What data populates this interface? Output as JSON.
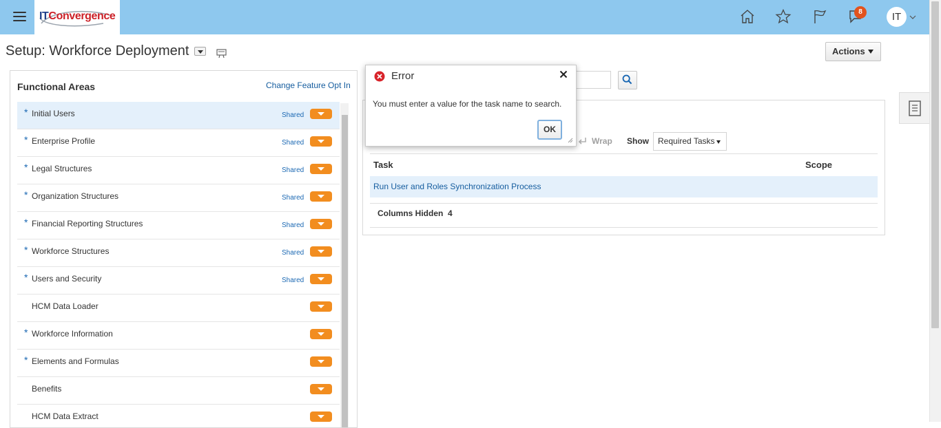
{
  "header": {
    "logo": {
      "part1": "IT",
      "part2": "Convergence",
      "brand_colors": {
        "it": "#1f3f8a",
        "conv": "#cc2027"
      }
    },
    "menu_icon": "hamburger-menu-icon",
    "icons": [
      "home-icon",
      "star-icon",
      "flag-icon",
      "notifications-icon"
    ],
    "notification_count": "8",
    "user_initials": "IT",
    "bar_color": "#8ec8ee"
  },
  "page": {
    "title": "Setup: Workforce Deployment",
    "actions_label": "Actions"
  },
  "functional_areas": {
    "heading": "Functional Areas",
    "change_link": "Change Feature Opt In",
    "items": [
      {
        "label": "Initial Users",
        "required": true,
        "shared": "Shared",
        "selected": true
      },
      {
        "label": "Enterprise Profile",
        "required": true,
        "shared": "Shared"
      },
      {
        "label": "Legal Structures",
        "required": true,
        "shared": "Shared"
      },
      {
        "label": "Organization Structures",
        "required": true,
        "shared": "Shared"
      },
      {
        "label": "Financial Reporting Structures",
        "required": true,
        "shared": "Shared"
      },
      {
        "label": "Workforce Structures",
        "required": true,
        "shared": "Shared"
      },
      {
        "label": "Users and Security",
        "required": true,
        "shared": "Shared"
      },
      {
        "label": "HCM Data Loader",
        "required": false,
        "shared": ""
      },
      {
        "label": "Workforce Information",
        "required": true,
        "shared": ""
      },
      {
        "label": "Elements and Formulas",
        "required": true,
        "shared": ""
      },
      {
        "label": "Benefits",
        "required": false,
        "shared": ""
      },
      {
        "label": "HCM Data Extract",
        "required": false,
        "shared": ""
      }
    ],
    "required_marker": "*"
  },
  "tasks": {
    "wrap_label": "Wrap",
    "show_label": "Show",
    "show_value": "Required Tasks",
    "columns": {
      "task": "Task",
      "scope": "Scope"
    },
    "rows": [
      {
        "task": "Run User and Roles Synchronization Process",
        "scope": ""
      }
    ],
    "columns_hidden_label": "Columns Hidden",
    "columns_hidden_count": "4"
  },
  "dialog": {
    "title": "Error",
    "message": "You must enter a value for the task name to search.",
    "ok_label": "OK"
  },
  "colors": {
    "accent_orange": "#f28d1f",
    "link_blue": "#145c9e",
    "selected_row": "#e4f0fb",
    "error_red": "#d8232a"
  }
}
